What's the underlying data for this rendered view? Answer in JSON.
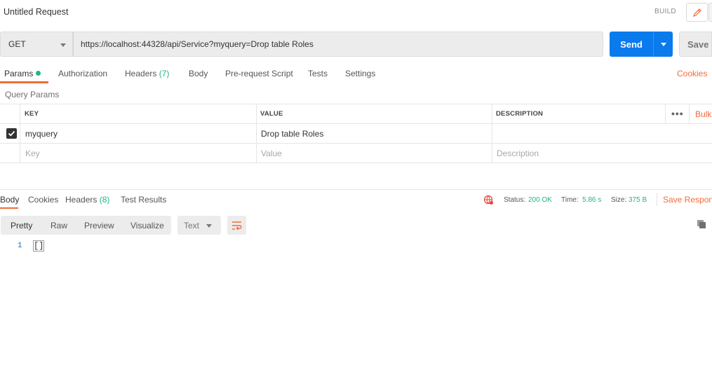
{
  "request": {
    "title": "Untitled Request",
    "build_label": "BUILD"
  },
  "url_bar": {
    "method": "GET",
    "url": "https://localhost:44328/api/Service?myquery=Drop table Roles",
    "send_label": "Send",
    "save_label": "Save"
  },
  "request_tabs": [
    {
      "label": "Params",
      "active": true
    },
    {
      "label": "Authorization"
    },
    {
      "label": "Headers",
      "count": "(7)"
    },
    {
      "label": "Body"
    },
    {
      "label": "Pre-request Script"
    },
    {
      "label": "Tests"
    },
    {
      "label": "Settings"
    }
  ],
  "cookies_link": "Cookies",
  "query_params": {
    "section_label": "Query Params",
    "headers": {
      "key": "KEY",
      "value": "VALUE",
      "description": "DESCRIPTION"
    },
    "more": "•••",
    "bulk_edit": "Bulk",
    "rows": [
      {
        "checked": true,
        "key": "myquery",
        "value": "Drop table Roles",
        "description": ""
      }
    ],
    "placeholder": {
      "key": "Key",
      "value": "Value",
      "description": "Description"
    }
  },
  "response": {
    "tabs": [
      {
        "label": "Body",
        "active": true
      },
      {
        "label": "Cookies"
      },
      {
        "label": "Headers",
        "count": "(8)"
      },
      {
        "label": "Test Results"
      }
    ],
    "status_label": "Status:",
    "status_value": "200 OK",
    "time_label": "Time:",
    "time_value": "5.86 s",
    "size_label": "Size:",
    "size_value": "375 B",
    "save_response": "Save Respons",
    "format_tabs": [
      "Pretty",
      "Raw",
      "Preview",
      "Visualize"
    ],
    "language": "Text",
    "body_lines": [
      {
        "no": "1",
        "text": "[]"
      }
    ]
  },
  "colors": {
    "accent": "#f26b3a",
    "send": "#097bed",
    "success": "#26b47f"
  }
}
